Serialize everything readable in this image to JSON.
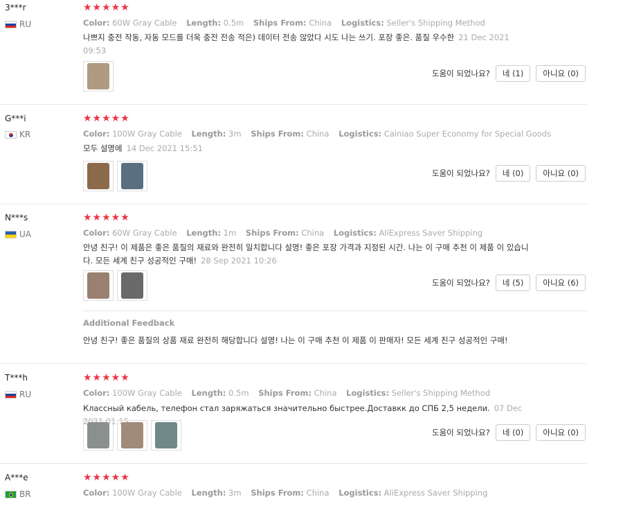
{
  "labels": {
    "color": "Color:",
    "length": "Length:",
    "ships_from": "Ships From:",
    "logistics": "Logistics:",
    "helpful_q": "도움이 되었나요?",
    "additional_feedback": "Additional Feedback"
  },
  "stars": "★★★★★",
  "reviews": [
    {
      "user": "3***r",
      "country": "RU",
      "color": "60W Gray Cable",
      "length": "0.5m",
      "ships_from": "China",
      "logistics": "Seller's Shipping Method",
      "text": "나쁘지 충전 작동, 자동 모드를 더욱 충전 전송 적은) 데이터 전송 않았다 시도 나는 쓰기. 포장 좋은. 품질 우수한",
      "date": "21 Dec 2021 09:53",
      "yes": "네 (1)",
      "no": "아니요 (0)"
    },
    {
      "user": "G***i",
      "country": "KR",
      "color": "100W Gray Cable",
      "length": "3m",
      "ships_from": "China",
      "logistics": "Cainiao Super Economy for Special Goods",
      "text": "모두 설명에",
      "date": "14 Dec 2021 15:51",
      "yes": "네 (0)",
      "no": "아니요 (0)"
    },
    {
      "user": "N***s",
      "country": "UA",
      "color": "60W Gray Cable",
      "length": "1m",
      "ships_from": "China",
      "logistics": "AliExpress Saver Shipping",
      "text": "안녕 친구! 이 제품은 좋은 품질의 재료와 완전히 일치합니다 설명! 좋은 포장 가격과 지정된 시간. 나는 이 구매 추천 이 제품 이 있습니다. 모든 세계 친구 성공적인 구매!",
      "date": "28 Sep 2021 10:26",
      "yes": "네 (5)",
      "no": "아니요 (6)",
      "additional": "안녕 친구! 좋은 품질의 상품 재료 완전히 해당합니다 설명! 나는 이 구매 추천 이 제품 이 판매자! 모든 세계 친구 성공적인 구매!"
    },
    {
      "user": "T***h",
      "country": "RU",
      "color": "100W Gray Cable",
      "length": "0.5m",
      "ships_from": "China",
      "logistics": "Seller's Shipping Method",
      "text": "Классный кабель, телефон стал заряжаться значительно быстрее.Доставкк до СПБ 2,5 недели.",
      "date": "07 Dec 2021 01:15",
      "yes": "네 (0)",
      "no": "아니요 (0)"
    },
    {
      "user": "A***e",
      "country": "BR",
      "color": "100W Gray Cable",
      "length": "3m",
      "ships_from": "China",
      "logistics": "AliExpress Saver Shipping"
    }
  ]
}
